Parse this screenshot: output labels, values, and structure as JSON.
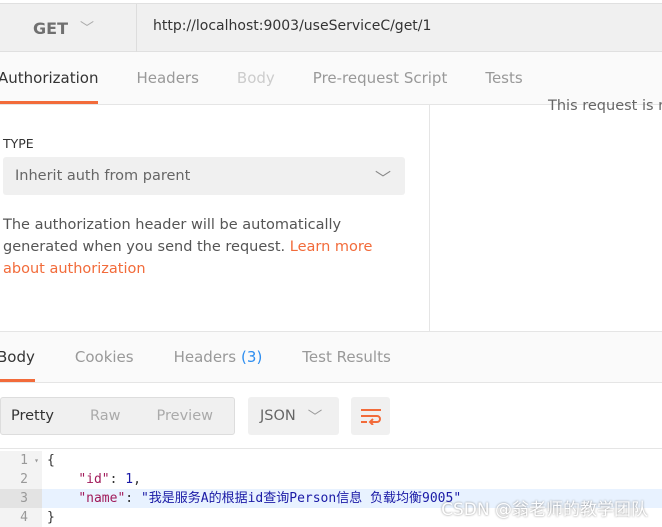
{
  "request": {
    "method": "GET",
    "url": "http://localhost:9003/useServiceC/get/1"
  },
  "request_tabs": [
    {
      "label": "Authorization",
      "active": true
    },
    {
      "label": "Headers"
    },
    {
      "label": "Body",
      "disabled": true
    },
    {
      "label": "Pre-request Script"
    },
    {
      "label": "Tests"
    }
  ],
  "auth": {
    "type_label": "TYPE",
    "type_value": "Inherit auth from parent",
    "description": "The authorization header will be automatically generated when you send the request. ",
    "learn_more": "Learn more about authorization",
    "right_text": "This request is n"
  },
  "response_tabs": [
    {
      "label": "Body",
      "active": true
    },
    {
      "label": "Cookies"
    },
    {
      "label": "Headers",
      "count": "(3)"
    },
    {
      "label": "Test Results"
    }
  ],
  "toolbar": {
    "formats": [
      "Pretty",
      "Raw",
      "Preview"
    ],
    "selected_format": "Pretty",
    "language": "JSON",
    "wrap_icon": "wrap-lines-icon"
  },
  "code": {
    "lines": [
      "1",
      "2",
      "3",
      "4"
    ],
    "open": "{",
    "id_key": "\"id\"",
    "id_val": "1",
    "name_key": "\"name\"",
    "name_val": "\"我是服务A的根据id查询Person信息 负载均衡9005\"",
    "close": "}"
  },
  "watermark": "CSDN @翁老师的教学团队",
  "colors": {
    "accent": "#f26b3a",
    "count": "#2e8ef0"
  }
}
